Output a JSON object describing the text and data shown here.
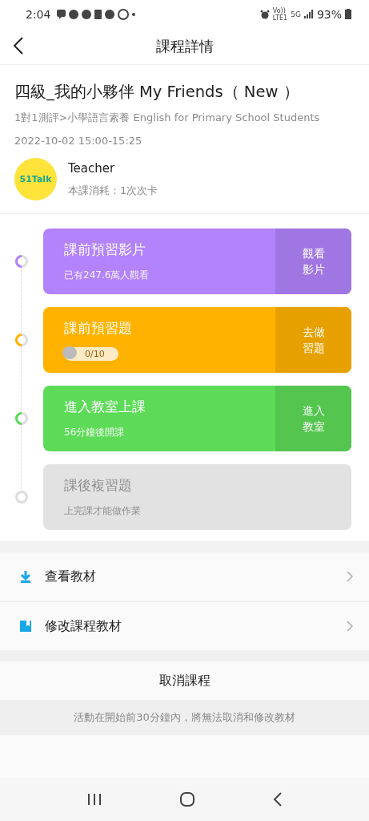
{
  "status_bar": {
    "time": "2:04",
    "volte": "Vo))",
    "lte": "LTE1",
    "network": "5G",
    "battery": "93%"
  },
  "header": {
    "title": "課程詳情"
  },
  "course": {
    "title": "四級_我的小夥伴 My Friends（ New ）",
    "category": "1對1測評>小學語言素養 English for Primary School Students",
    "datetime": "2022-10-02 15:00-15:25"
  },
  "teacher": {
    "logo": "51Talk",
    "name": "Teacher",
    "cost": "本課消耗：1次次卡"
  },
  "steps": [
    {
      "kind": "info",
      "title": "課前預習影片",
      "subtitle": "已有247.6萬人觀看",
      "action": "觀看影片",
      "color": "#b283fb",
      "disabled": false
    },
    {
      "kind": "progress",
      "title": "課前預習題",
      "progress": "0/10",
      "level": 0,
      "action": "去做習題",
      "color": "#ffb300",
      "disabled": false
    },
    {
      "kind": "info",
      "title": "進入教室上課",
      "subtitle": "56分鐘後開課",
      "action": "進入教室",
      "color": "#5ddb58",
      "disabled": false
    },
    {
      "kind": "info",
      "title": "課後複習題",
      "subtitle": "上完課才能做作業",
      "color": "#e2e2e2",
      "disabled": true
    }
  ],
  "menu": [
    {
      "kind": "download",
      "label": "查看教材"
    },
    {
      "kind": "book",
      "label": "修改課程教材"
    }
  ],
  "cancel_button": "取消課程",
  "notice": "活動在開始前30分鐘內，將無法取消和修改教材"
}
